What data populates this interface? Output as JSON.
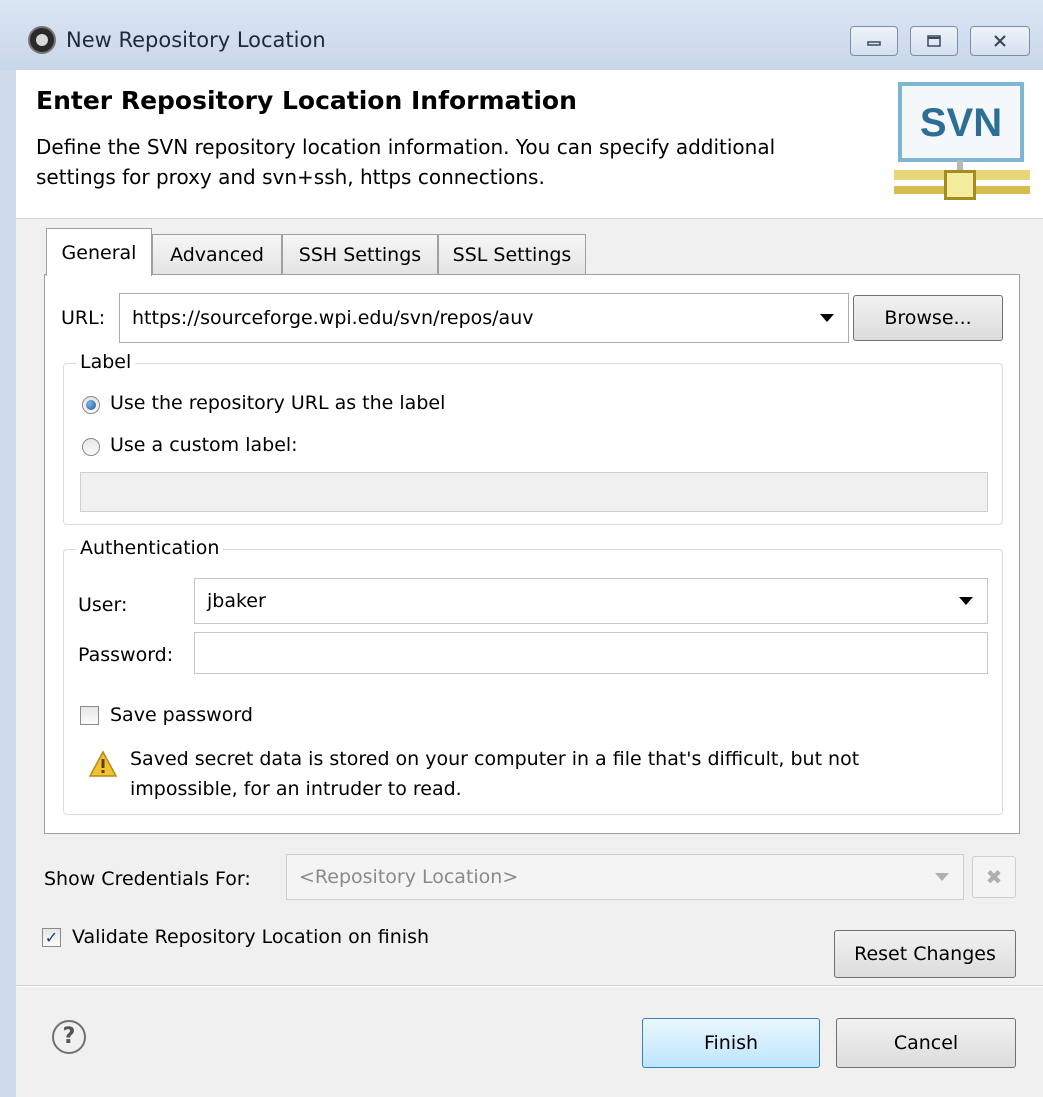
{
  "window": {
    "title": "New Repository Location",
    "min_icon": "minimize-icon",
    "max_icon": "maximize-icon",
    "close_icon": "close-icon"
  },
  "header": {
    "title": "Enter Repository Location Information",
    "description": "Define the SVN repository location information. You can specify additional settings for proxy and svn+ssh, https connections.",
    "logo_text": "SVN"
  },
  "tabs": [
    {
      "label": "General",
      "active": true
    },
    {
      "label": "Advanced",
      "active": false
    },
    {
      "label": "SSH Settings",
      "active": false
    },
    {
      "label": "SSL Settings",
      "active": false
    }
  ],
  "general": {
    "url_label": "URL:",
    "url_value": "https://sourceforge.wpi.edu/svn/repos/auv",
    "browse_label": "Browse...",
    "label_group": {
      "title": "Label",
      "option_url": "Use the repository URL as the label",
      "option_custom": "Use a custom label:",
      "selected": "url",
      "custom_value": ""
    },
    "auth_group": {
      "title": "Authentication",
      "user_label": "User:",
      "user_value": "jbaker",
      "password_label": "Password:",
      "password_value": "",
      "save_password_label": "Save password",
      "save_password_checked": false,
      "warning_text": "Saved secret data is stored on your computer in a file that's difficult, but not impossible, for an intruder to read."
    }
  },
  "credentials": {
    "label": "Show Credentials For:",
    "value": "<Repository Location>"
  },
  "validate": {
    "label": "Validate Repository Location on finish",
    "checked": true
  },
  "buttons": {
    "reset": "Reset Changes",
    "finish": "Finish",
    "cancel": "Cancel",
    "help_glyph": "?"
  },
  "colors": {
    "accent": "#3c7fb1",
    "warning": "#f2c230",
    "window_frame": "#cfdcec"
  }
}
